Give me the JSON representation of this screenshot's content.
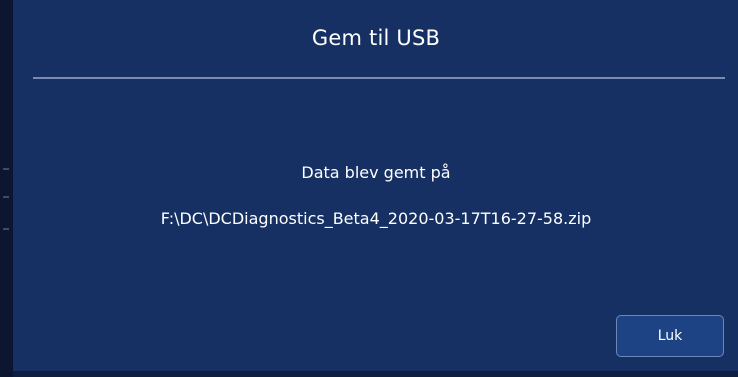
{
  "dialog": {
    "title": "Gem til USB",
    "message": "Data blev gemt på",
    "file_path": "F:\\DC\\DCDiagnostics_Beta4_2020-03-17T16-27-58.zip",
    "close_label": "Luk"
  },
  "colors": {
    "dialog_background": "#163063",
    "divider": "#8d9bbd",
    "button_background": "#1e4384",
    "button_border": "#6f86b8",
    "text": "#ffffff"
  }
}
